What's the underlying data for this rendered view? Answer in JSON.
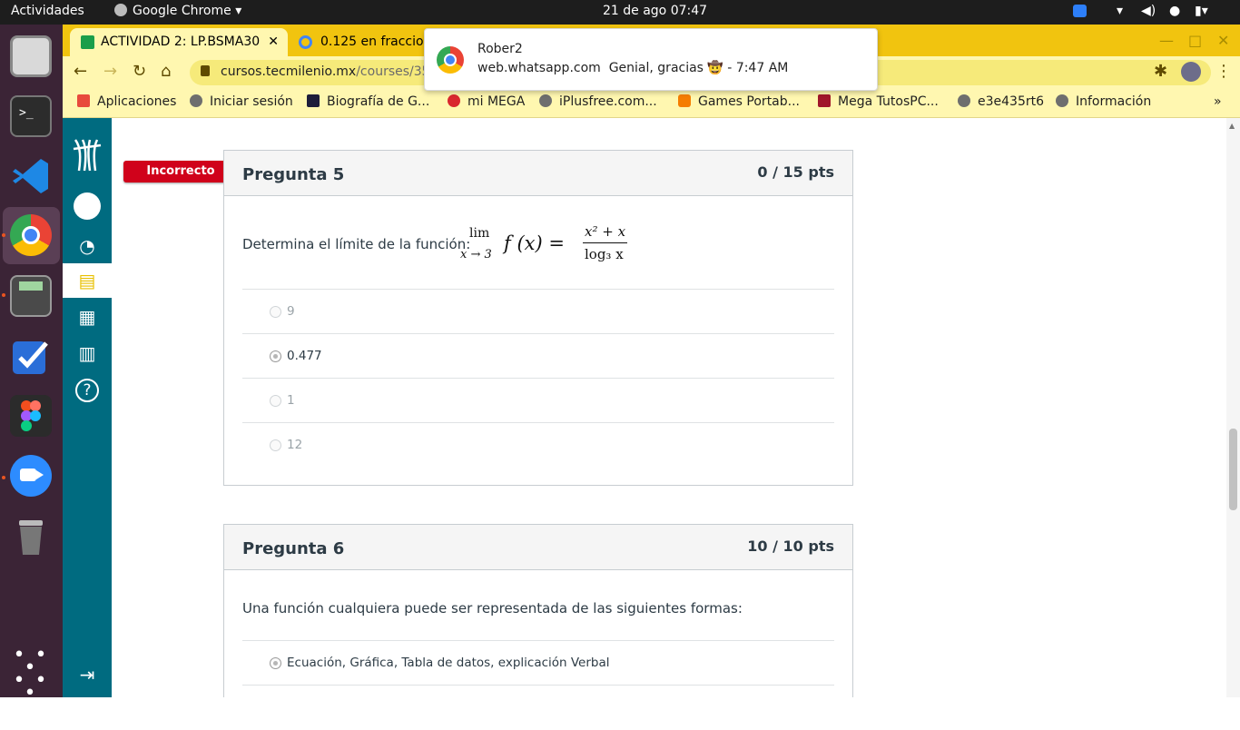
{
  "system_bar": {
    "activities": "Actividades",
    "app_name": "Google Chrome",
    "clock": "21 de ago  07:47"
  },
  "browser": {
    "tabs": [
      {
        "label": "ACTIVIDAD 2: LP.BSMA30",
        "active": true
      },
      {
        "label": "0.125 en fraccion",
        "active": false
      }
    ],
    "url_domain": "cursos.tecmilenio.mx",
    "url_path": "/courses/3528",
    "bookmarks": [
      {
        "label": "Aplicaciones"
      },
      {
        "label": "Iniciar sesión"
      },
      {
        "label": "Biografía de G..."
      },
      {
        "label": "mi MEGA"
      },
      {
        "label": "iPlusfree.com..."
      },
      {
        "label": "Games Portab..."
      },
      {
        "label": "Mega TutosPC..."
      },
      {
        "label": "e3e435rt6"
      },
      {
        "label": "Información"
      }
    ]
  },
  "notification": {
    "title": "Rober2",
    "source": "web.whatsapp.com",
    "message": "Genial, gracias 🤠 - 7:47 AM"
  },
  "quiz": {
    "questions": [
      {
        "badge": "Incorrecto",
        "title": "Pregunta 5",
        "points": "0 / 15 pts",
        "prompt": "Determina el límite de la función:",
        "formula": {
          "lim": "lim",
          "sub": "x → 3",
          "func": "f (x) =",
          "num": "x² + x",
          "den": "log₃ x"
        },
        "answers": [
          {
            "label": "9",
            "selected": false
          },
          {
            "label": "0.477",
            "selected": true
          },
          {
            "label": "1",
            "selected": false
          },
          {
            "label": "12",
            "selected": false
          }
        ]
      },
      {
        "title": "Pregunta 6",
        "points": "10 / 10 pts",
        "prompt": "Una función cualquiera puede ser representada de las siguientes formas:",
        "answers": [
          {
            "label": "Ecuación, Gráfica, Tabla de datos, explicación Verbal",
            "selected": true
          }
        ]
      }
    ]
  },
  "colors": {
    "browser_theme": "#f1c40f",
    "course_nav": "#006b80",
    "incorrect_badge": "#d0021b",
    "dock": "#3b2436"
  }
}
